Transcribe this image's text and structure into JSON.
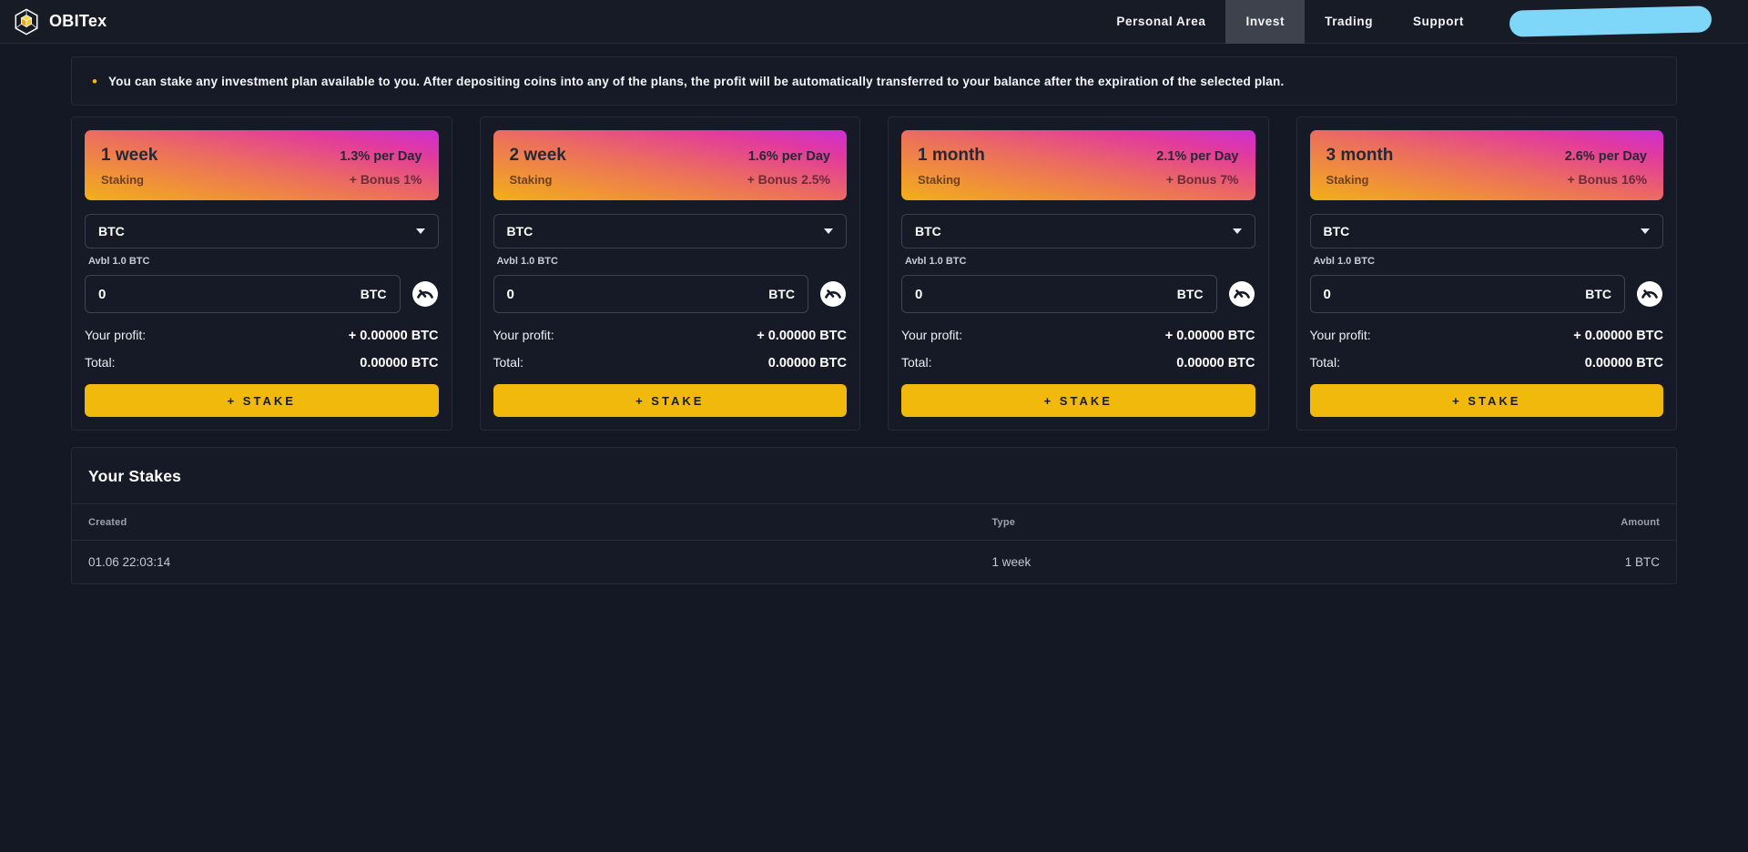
{
  "nav": {
    "brand": "OBITex",
    "items": [
      {
        "label": "Personal Area",
        "active": false
      },
      {
        "label": "Invest",
        "active": true
      },
      {
        "label": "Trading",
        "active": false
      },
      {
        "label": "Support",
        "active": false
      }
    ]
  },
  "banner": {
    "bullet": "•",
    "text": "You can stake any investment plan available to you. After depositing coins into any of the plans, the profit will be automatically transferred to your balance after the expiration of the selected plan."
  },
  "plans": [
    {
      "name": "1 week",
      "subtitle": "Staking",
      "rate": "1.3% per Day",
      "bonus": "+ Bonus 1%",
      "currency": "BTC",
      "available": "Avbl 1.0 BTC",
      "amount_value": "0",
      "amount_unit": "BTC",
      "profit_label": "Your profit:",
      "profit_value": "+ 0.00000 BTC",
      "total_label": "Total:",
      "total_value": "0.00000 BTC",
      "stake_label": "+ STAKE"
    },
    {
      "name": "2 week",
      "subtitle": "Staking",
      "rate": "1.6% per Day",
      "bonus": "+ Bonus 2.5%",
      "currency": "BTC",
      "available": "Avbl 1.0 BTC",
      "amount_value": "0",
      "amount_unit": "BTC",
      "profit_label": "Your profit:",
      "profit_value": "+ 0.00000 BTC",
      "total_label": "Total:",
      "total_value": "0.00000 BTC",
      "stake_label": "+ STAKE"
    },
    {
      "name": "1 month",
      "subtitle": "Staking",
      "rate": "2.1% per Day",
      "bonus": "+ Bonus 7%",
      "currency": "BTC",
      "available": "Avbl 1.0 BTC",
      "amount_value": "0",
      "amount_unit": "BTC",
      "profit_label": "Your profit:",
      "profit_value": "+ 0.00000 BTC",
      "total_label": "Total:",
      "total_value": "0.00000 BTC",
      "stake_label": "+ STAKE"
    },
    {
      "name": "3 month",
      "subtitle": "Staking",
      "rate": "2.6% per Day",
      "bonus": "+ Bonus 16%",
      "currency": "BTC",
      "available": "Avbl 1.0 BTC",
      "amount_value": "0",
      "amount_unit": "BTC",
      "profit_label": "Your profit:",
      "profit_value": "+ 0.00000 BTC",
      "total_label": "Total:",
      "total_value": "0.00000 BTC",
      "stake_label": "+ STAKE"
    }
  ],
  "stakes": {
    "title": "Your Stakes",
    "columns": [
      "Created",
      "Type",
      "Amount"
    ],
    "rows": [
      [
        "01.06 22:03:14",
        "1 week",
        "1 BTC"
      ]
    ]
  },
  "colors": {
    "accent_yellow": "#f0b90b",
    "redaction_blue": "#7ed7f8",
    "header_gradient": [
      "#f2b018",
      "#ec6e5e",
      "#e23a9d",
      "#cb2fd3"
    ],
    "page_bg": "#141824",
    "panel_bg": "#151a26",
    "border": "#262b37",
    "nav_bg": "#171b26",
    "nav_active_bg": "#3d424d"
  }
}
